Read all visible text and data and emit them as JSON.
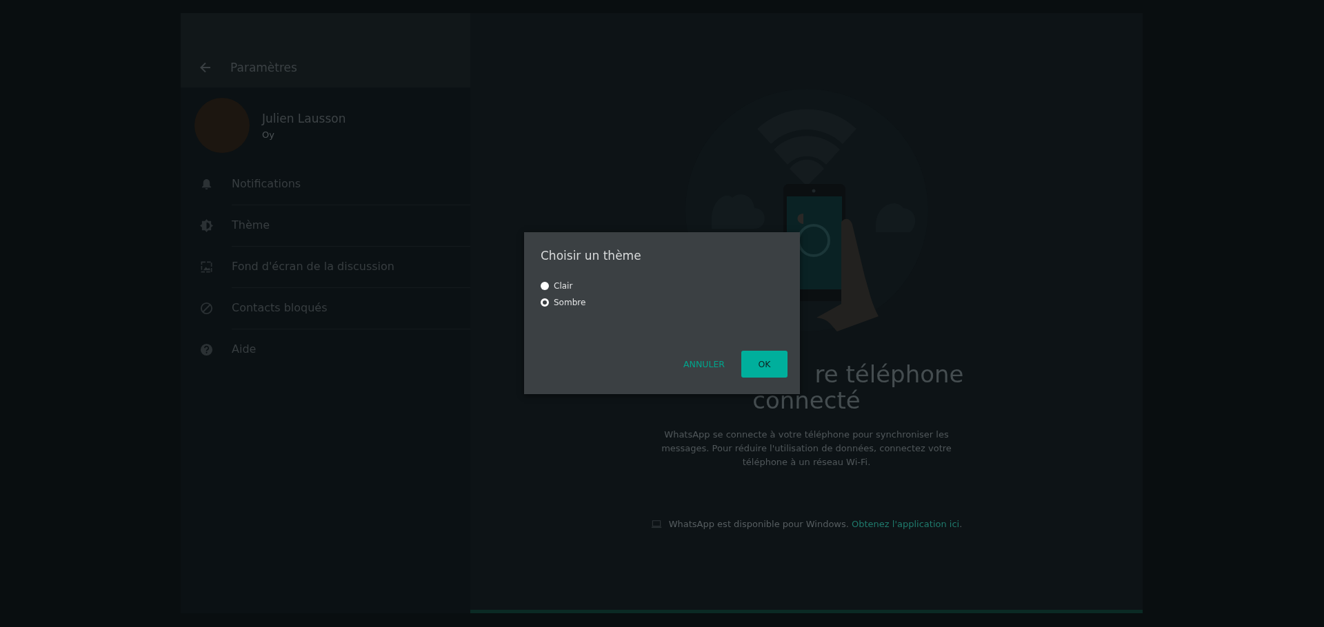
{
  "header": {
    "title": "Paramètres"
  },
  "profile": {
    "name": "Julien Lausson",
    "status": "Oy"
  },
  "menu": [
    {
      "kind": "bell",
      "label": "Notifications"
    },
    {
      "kind": "theme",
      "label": "Thème"
    },
    {
      "kind": "wallpaper",
      "label": "Fond d'écran de la discussion"
    },
    {
      "kind": "blocked",
      "label": "Contacts bloqués"
    },
    {
      "kind": "help",
      "label": "Aide"
    }
  ],
  "main": {
    "heading_lines": [
      "re téléphone",
      "connecté"
    ],
    "description": "WhatsApp se connecte à votre téléphone pour synchroniser les messages. Pour réduire l'utilisation de données, connectez votre téléphone à un réseau Wi-Fi.",
    "note": {
      "text": "WhatsApp est disponible pour Windows.",
      "link": "Obtenez l'application ici",
      "after": "."
    }
  },
  "dialog": {
    "title": "Choisir un thème",
    "options": [
      {
        "label": "Clair",
        "selected": false
      },
      {
        "label": "Sombre",
        "selected": true
      }
    ],
    "buttons": [
      {
        "kind": "text",
        "label": "ANNULER"
      },
      {
        "kind": "filled",
        "label": "OK"
      }
    ]
  }
}
